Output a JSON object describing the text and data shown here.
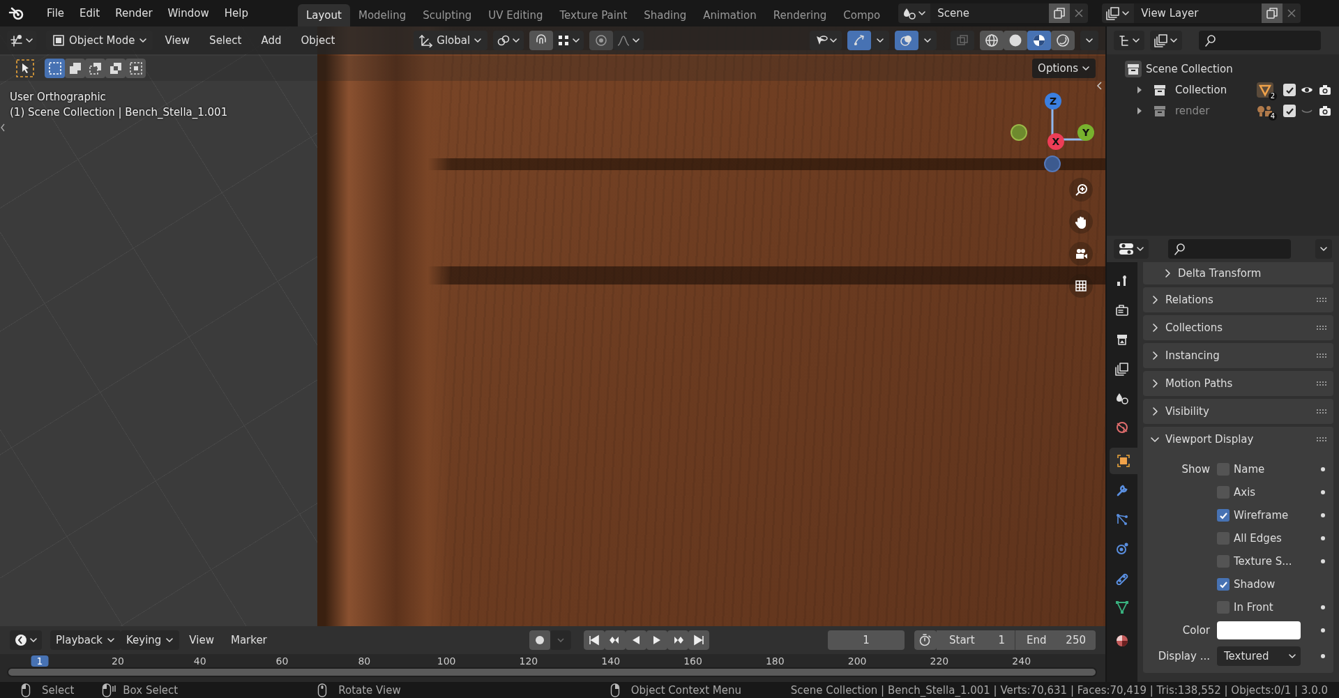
{
  "menu": [
    "File",
    "Edit",
    "Render",
    "Window",
    "Help"
  ],
  "workspaces": [
    {
      "label": "Layout",
      "selected": true
    },
    {
      "label": "Modeling",
      "selected": false
    },
    {
      "label": "Sculpting",
      "selected": false
    },
    {
      "label": "UV Editing",
      "selected": false
    },
    {
      "label": "Texture Paint",
      "selected": false
    },
    {
      "label": "Shading",
      "selected": false
    },
    {
      "label": "Animation",
      "selected": false
    },
    {
      "label": "Rendering",
      "selected": false
    },
    {
      "label": "Compo",
      "selected": false
    }
  ],
  "scene": "Scene",
  "view_layer": "View Layer",
  "viewport": {
    "mode": "Object Mode",
    "menus": [
      "View",
      "Select",
      "Add",
      "Object"
    ],
    "orientation": "Global",
    "gizmos": true,
    "overlays": true,
    "xray": false,
    "shading": [
      {
        "kind": "wireframe",
        "selected": false
      },
      {
        "kind": "solid",
        "selected": false
      },
      {
        "kind": "material",
        "selected": true
      },
      {
        "kind": "rendered",
        "selected": false
      }
    ],
    "select_modes": [
      {
        "kind": "set",
        "selected": true
      },
      {
        "kind": "extend",
        "selected": false
      },
      {
        "kind": "subtract",
        "selected": false
      },
      {
        "kind": "difference",
        "selected": false
      },
      {
        "kind": "intersect",
        "selected": false
      }
    ],
    "options": "Options",
    "view_name": "User Orthographic",
    "object_info": "(1) Scene Collection | Bench_Stella_1.001",
    "axes": [
      {
        "label": "Z",
        "color": "#3b7fe0"
      },
      {
        "label": "Y",
        "color": "#78b22e"
      },
      {
        "label": "X",
        "color": "#ee3d57"
      }
    ]
  },
  "outliner": {
    "root": "Scene Collection",
    "items": [
      {
        "label": "Collection",
        "kind": "collection",
        "expanded": false,
        "enabled": true,
        "checked": true,
        "visible": true,
        "badge": "2"
      },
      {
        "label": "render",
        "kind": "lights",
        "expanded": false,
        "enabled": false,
        "checked": true,
        "visible": false,
        "badge": "4"
      }
    ]
  },
  "properties": {
    "tabs": [
      {
        "kind": "tool",
        "selected": false
      },
      {
        "kind": "render",
        "selected": false
      },
      {
        "kind": "output",
        "selected": false
      },
      {
        "kind": "view_layer",
        "selected": false
      },
      {
        "kind": "scene",
        "selected": false
      },
      {
        "kind": "world",
        "selected": false
      },
      {
        "kind": "object",
        "selected": true
      },
      {
        "kind": "modifiers",
        "selected": false
      },
      {
        "kind": "particles",
        "selected": false
      },
      {
        "kind": "physics",
        "selected": false
      },
      {
        "kind": "constraints",
        "selected": false
      },
      {
        "kind": "data",
        "selected": false
      },
      {
        "kind": "material",
        "selected": false
      }
    ],
    "panels": [
      {
        "label": "Delta Transform",
        "kind": "subpanel",
        "expanded": false
      },
      {
        "label": "Relations",
        "kind": "panel",
        "expanded": false
      },
      {
        "label": "Collections",
        "kind": "panel",
        "expanded": false
      },
      {
        "label": "Instancing",
        "kind": "panel",
        "expanded": false
      },
      {
        "label": "Motion Paths",
        "kind": "panel",
        "expanded": false
      },
      {
        "label": "Visibility",
        "kind": "panel",
        "expanded": false
      },
      {
        "label": "Viewport Display",
        "kind": "panel",
        "expanded": true
      }
    ],
    "viewport_display": {
      "show_label": "Show",
      "options": [
        {
          "label": "Name",
          "checked": false,
          "keyframe_dot": true
        },
        {
          "label": "Axis",
          "checked": false,
          "keyframe_dot": true
        },
        {
          "label": "Wireframe",
          "checked": true,
          "keyframe_dot": true
        },
        {
          "label": "All Edges",
          "checked": false,
          "keyframe_dot": true
        },
        {
          "label": "Texture S...",
          "checked": false,
          "keyframe_dot": true
        },
        {
          "label": "Shadow",
          "checked": true,
          "keyframe_dot": false
        },
        {
          "label": "In Front",
          "checked": false,
          "keyframe_dot": true
        }
      ],
      "color_label": "Color",
      "display_label": "Display ...",
      "display_as": "Textured"
    }
  },
  "timeline": {
    "menus": [
      {
        "label": "Playback",
        "kind": "dropdown"
      },
      {
        "label": "Keying",
        "kind": "dropdown"
      },
      {
        "label": "View",
        "kind": "menu"
      },
      {
        "label": "Marker",
        "kind": "menu"
      }
    ],
    "auto_keying": false,
    "current_frame": "1",
    "start_label": "Start",
    "start": "1",
    "end_label": "End",
    "end": "250",
    "ruler": [
      "1",
      "20",
      "40",
      "60",
      "80",
      "100",
      "120",
      "140",
      "160",
      "180",
      "200",
      "220",
      "240"
    ]
  },
  "status_bar": {
    "hints": [
      {
        "label": "Select",
        "kind": "left"
      },
      {
        "label": "Box Select",
        "kind": "drag"
      },
      {
        "label": "Rotate View",
        "kind": "middle"
      },
      {
        "label": "Object Context Menu",
        "kind": "right"
      }
    ],
    "stats": "Scene Collection | Bench_Stella_1.001 | Verts:70,631 | Faces:70,419 | Tris:138,552 | Objects:0/1 | 3.0.0"
  }
}
